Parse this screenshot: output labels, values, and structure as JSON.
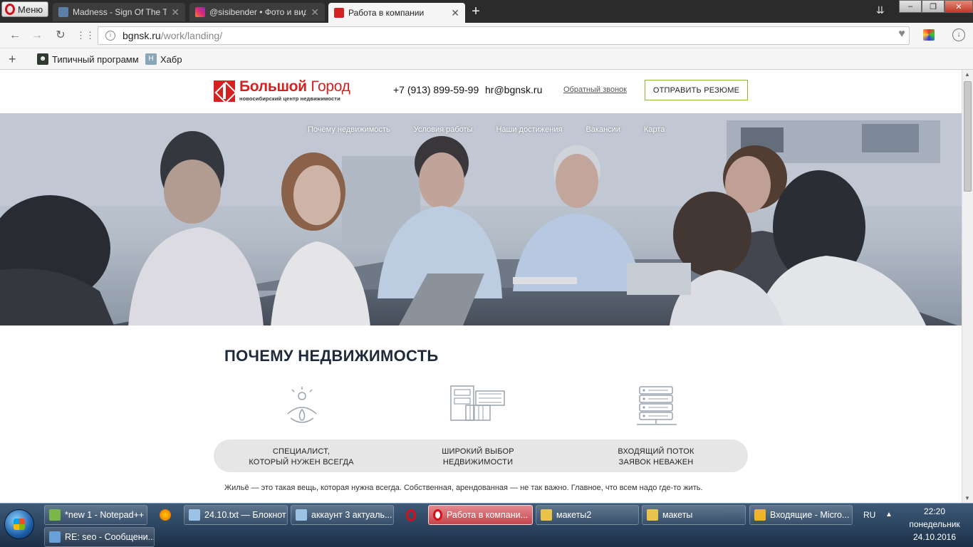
{
  "browser": {
    "menu_label": "Меню",
    "tabs": [
      {
        "label": "Madness - Sign Of The Tim",
        "icon": "madness-icon",
        "color": "#5b7fa6"
      },
      {
        "label": "@sisibender • Фото и вид",
        "icon": "instagram-icon",
        "color": "#c13584"
      },
      {
        "label": "Работа в компании",
        "icon": "bgnsk-favicon",
        "color": "#d32222",
        "active": true
      }
    ],
    "new_tab": "+",
    "window_controls": {
      "minimize": "–",
      "maximize": "❐",
      "close": "✕"
    },
    "url_domain": "bgnsk.ru",
    "url_path": "/work/landing/",
    "bookmarks": [
      {
        "label": "Типичный программ",
        "icon": "typical-programmer-icon"
      },
      {
        "label": "Хабр",
        "icon": "habr-icon",
        "glyph": "H"
      }
    ]
  },
  "site": {
    "logo_title_bold": "Большой",
    "logo_title_light": "Город",
    "logo_subtitle": "новосибирский центр недвижимости",
    "phone": "+7 (913) 899-59-99",
    "email": "hr@bgnsk.ru",
    "callback_link": "Обратный звонок",
    "resume_button": "ОТПРАВИТЬ РЕЗЮМЕ",
    "nav": [
      "Почему недвижимость",
      "Условия работы",
      "Наши достижения",
      "Вакансии",
      "Карта"
    ],
    "section_title": "ПОЧЕМУ НЕДВИЖИМОСТЬ",
    "features": [
      {
        "line1": "СПЕЦИАЛИСТ,",
        "line2": "КОТОРЫЙ НУЖЕН ВСЕГДА",
        "icon": "specialist-icon"
      },
      {
        "line1": "ШИРОКИЙ ВЫБОР",
        "line2": "НЕДВИЖИМОСТИ",
        "icon": "buildings-icon"
      },
      {
        "line1": "ВХОДЯЩИЙ ПОТОК",
        "line2": "ЗАЯВОК НЕВАЖЕН",
        "icon": "server-icon"
      }
    ],
    "intro_text": "Жильё — это такая вещь, которая нужна всегда. Собственная, арендованная — не так важно. Главное, что всем надо где-то жить.",
    "brand_color": "#d32222",
    "accent_color": "#8bb830"
  },
  "taskbar": {
    "items": [
      {
        "label": "*new 1 - Notepad++",
        "icon": "notepadpp-icon",
        "color": "#7ab648"
      },
      {
        "label": "",
        "icon": "firefox-icon",
        "color": "#e66000"
      },
      {
        "label": "24.10.txt — Блокнот",
        "icon": "notepad-icon",
        "color": "#9cc3e6"
      },
      {
        "label": "аккаунт 3 актуаль...",
        "icon": "notepad-icon",
        "color": "#9cc3e6"
      },
      {
        "label": "",
        "icon": "opera-icon",
        "color": "#d5101a"
      },
      {
        "label": "Работа в компани...",
        "icon": "opera-icon",
        "color": "#d5101a",
        "active": true
      },
      {
        "label": "макеты2",
        "icon": "folder-icon",
        "color": "#e8c44a"
      },
      {
        "label": "макеты",
        "icon": "folder-icon",
        "color": "#e8c44a"
      },
      {
        "label": "Входящие - Micro...",
        "icon": "outlook-icon",
        "color": "#f0b429"
      },
      {
        "label": "RE: seo - Сообщени...",
        "icon": "mail-message-icon",
        "color": "#6aa0d8"
      }
    ],
    "language": "RU",
    "tray_arrow": "▲",
    "time": "22:20",
    "weekday": "понедельник",
    "date": "24.10.2016"
  }
}
